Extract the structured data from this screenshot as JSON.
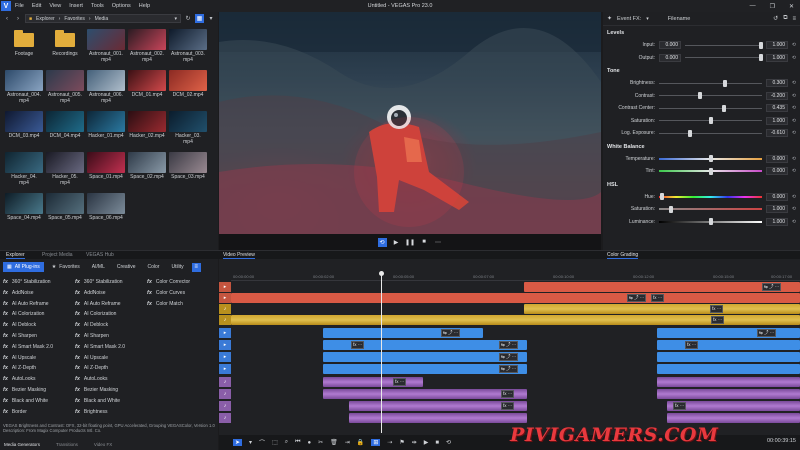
{
  "window": {
    "title": "Untitled - VEGAS Pro 23.0",
    "logo": "V",
    "controls": [
      "—",
      "❐",
      "✕"
    ],
    "menu": [
      "File",
      "Edit",
      "View",
      "Insert",
      "Tools",
      "Options",
      "Help"
    ]
  },
  "explorer": {
    "path": [
      "Explorer",
      "Favorites",
      "Media"
    ],
    "items": [
      {
        "name": "Footage",
        "kind": "folder"
      },
      {
        "name": "Recordings",
        "kind": "folder"
      },
      {
        "name": "Astronaut_001.\nmp4",
        "kind": "video",
        "colors": [
          "#2d4e6e",
          "#6b2a34"
        ]
      },
      {
        "name": "Astronaut_002.\nmp4",
        "kind": "video",
        "colors": [
          "#2a1b22",
          "#c9455a"
        ]
      },
      {
        "name": "Astronaut_003.\nmp4",
        "kind": "video",
        "colors": [
          "#0e1a2a",
          "#5b6e87"
        ]
      },
      {
        "name": "Astronaut_004.\nmp4",
        "kind": "video",
        "colors": [
          "#2d4a6a",
          "#8aa4c2"
        ]
      },
      {
        "name": "Astronaut_005.\nmp4",
        "kind": "video",
        "colors": [
          "#2c3a4c",
          "#7d4b5c"
        ]
      },
      {
        "name": "Astronaut_006.\nmp4",
        "kind": "video",
        "colors": [
          "#44607a",
          "#b1bfcc"
        ]
      },
      {
        "name": "DCM_01.mp4",
        "kind": "video",
        "colors": [
          "#3a1014",
          "#d3494b"
        ]
      },
      {
        "name": "DCM_02.mp4",
        "kind": "video",
        "colors": [
          "#8b2a23",
          "#e06248"
        ]
      },
      {
        "name": "DCM_03.mp4",
        "kind": "video",
        "colors": [
          "#0f1830",
          "#3a5a96"
        ]
      },
      {
        "name": "DCM_04.mp4",
        "kind": "video",
        "colors": [
          "#0c2534",
          "#1f6c8a"
        ]
      },
      {
        "name": "Hacker_01.mp4",
        "kind": "video",
        "colors": [
          "#0d2638",
          "#2b7aa2"
        ]
      },
      {
        "name": "Hacker_02.mp4",
        "kind": "video",
        "colors": [
          "#2a0e12",
          "#9a2a30"
        ]
      },
      {
        "name": "Hacker_03.\nmp4",
        "kind": "video",
        "colors": [
          "#0b1c2c",
          "#21506c"
        ]
      },
      {
        "name": "Hacker_04.\nmp4",
        "kind": "video",
        "colors": [
          "#0f2430",
          "#3a6a82"
        ]
      },
      {
        "name": "Hacker_05.\nmp4",
        "kind": "video",
        "colors": [
          "#1a1a24",
          "#6a6a82"
        ]
      },
      {
        "name": "Space_01.mp4",
        "kind": "video",
        "colors": [
          "#3a0c18",
          "#c23050"
        ]
      },
      {
        "name": "Space_02.mp4",
        "kind": "video",
        "colors": [
          "#2e3a48",
          "#8a9aa8"
        ]
      },
      {
        "name": "Space_03.mp4",
        "kind": "video",
        "colors": [
          "#3a3a44",
          "#9a8a92"
        ]
      },
      {
        "name": "Space_04.mp4",
        "kind": "video",
        "colors": [
          "#0e1c26",
          "#4a7a8c"
        ]
      },
      {
        "name": "Space_05.mp4",
        "kind": "video",
        "colors": [
          "#1c2a36",
          "#56707e"
        ]
      },
      {
        "name": "Space_06.mp4",
        "kind": "video",
        "colors": [
          "#2a3442",
          "#7c8c9a"
        ]
      }
    ]
  },
  "eventfx": {
    "title": "Event FX:",
    "filename": "Filename",
    "sections": [
      {
        "title": "Levels",
        "rows": [
          {
            "label": "Input:",
            "field": "0.000",
            "value": "1.000",
            "pos": 0.99
          },
          {
            "label": "Output:",
            "field": "0.000",
            "value": "1.000",
            "pos": 0.99
          }
        ]
      },
      {
        "title": "Tone",
        "rows": [
          {
            "label": "Brightness:",
            "value": "0.300",
            "pos": 0.64
          },
          {
            "label": "Contrast:",
            "value": "-0.200",
            "pos": 0.4
          },
          {
            "label": "Contrast Center:",
            "value": "0.435",
            "pos": 0.63
          },
          {
            "label": "Saturation:",
            "value": "1.000",
            "pos": 0.5
          },
          {
            "label": "Log. Exposure:",
            "value": "-0.610",
            "pos": 0.3
          }
        ]
      },
      {
        "title": "White Balance",
        "rows": [
          {
            "label": "Temperature:",
            "value": "0.000",
            "pos": 0.5,
            "gradient": "linear-gradient(90deg,#3a6ad6,#e8e8e8,#e6a040)"
          },
          {
            "label": "Tint:",
            "value": "0.000",
            "pos": 0.5,
            "gradient": "linear-gradient(90deg,#3ac84a,#e8e8e8,#c84ac8)"
          }
        ]
      },
      {
        "title": "HSL",
        "rows": [
          {
            "label": "Hue:",
            "value": "0.000",
            "pos": 0.03,
            "gradient": "linear-gradient(90deg,#e33,#ee3,#3e3,#3ee,#33e,#e3e,#e33)"
          },
          {
            "label": "Saturation:",
            "value": "1.000",
            "pos": 0.12,
            "gradient": "linear-gradient(90deg,#888,#c44)"
          },
          {
            "label": "Luminance:",
            "value": "1.000",
            "pos": 0.5,
            "gradient": "linear-gradient(90deg,#000,#fff)"
          }
        ]
      }
    ]
  },
  "panel_tabs": [
    "Explorer",
    "Project Media",
    "VEGAS Hub",
    "Video Preview",
    "Color Grading"
  ],
  "plugins": {
    "filters": [
      "All Plug-ins",
      "Favorites",
      "AI/ML",
      "Creative",
      "Color",
      "Utility"
    ],
    "fx_glyph": "fx",
    "items": [
      "360° Stabilization",
      "AddNoise",
      "AI Auto Reframe",
      "AI Colorization",
      "AI Deblock",
      "AI Sharpen",
      "AI Smart Mask 2.0",
      "AI Upscale",
      "AI Z-Depth",
      "AutoLooks",
      "Bezier Masking",
      "Black and White",
      "Border",
      "360° Stabilization",
      "AddNoise",
      "AI Auto Reframe",
      "AI Colorization",
      "AI Deblock",
      "AI Sharpen",
      "AI Smart Mask 2.0",
      "AI Upscale",
      "AI Z-Depth",
      "AutoLooks",
      "Bezier Masking",
      "Black and White",
      "Brightness",
      "Color Corrector",
      "Color Curves",
      "Color Match"
    ],
    "info": "VEGAS Brightness and Contrast: OFX, 32-bit floating point, GPU Accelerated, Grouping VEGASColor, Version 1.0 Description: From Magix Computer Products Intl. Co.",
    "bottom_tabs": [
      "Media Generators",
      "Transitions",
      "Video FX"
    ]
  },
  "timeline": {
    "ruler": [
      "00:00:00:00",
      "00:00:02:00",
      "00:00:05:00",
      "00:00:07:00",
      "00:00:10:00",
      "00:00:12:00",
      "00:00:15:00",
      "00:00:17:00"
    ],
    "timecode": "00:00:39:15"
  },
  "watermark": "PIVIGAMERS.COM"
}
